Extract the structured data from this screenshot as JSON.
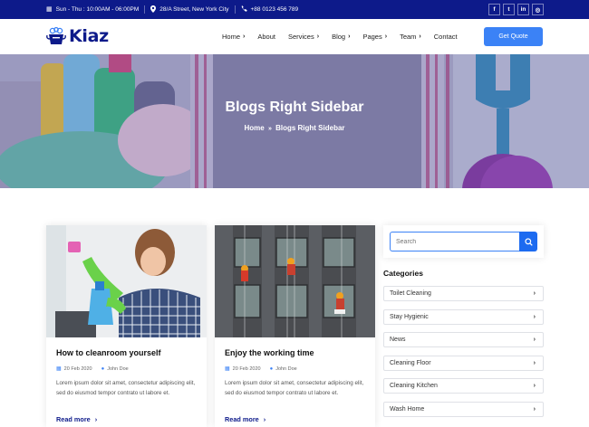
{
  "topbar": {
    "hours": "Sun - Thu : 10:00AM - 06:00PM",
    "address": "28/A Street, New York City",
    "phone": "+88 0123 456 789",
    "social": [
      {
        "name": "facebook-icon",
        "glyph": "f"
      },
      {
        "name": "twitter-icon",
        "glyph": "t"
      },
      {
        "name": "linkedin-icon",
        "glyph": "in"
      },
      {
        "name": "instagram-icon",
        "glyph": "◎"
      }
    ]
  },
  "header": {
    "brand": "Kiaz",
    "nav": [
      {
        "label": "Home",
        "dropdown": true
      },
      {
        "label": "About",
        "dropdown": false
      },
      {
        "label": "Services",
        "dropdown": true
      },
      {
        "label": "Blog",
        "dropdown": true
      },
      {
        "label": "Pages",
        "dropdown": true
      },
      {
        "label": "Team",
        "dropdown": true
      },
      {
        "label": "Contact",
        "dropdown": false
      }
    ],
    "cta": "Get Quote"
  },
  "hero": {
    "title": "Blogs Right Sidebar",
    "crumb_home": "Home",
    "crumb_sep": "»",
    "crumb_current": "Blogs Right Sidebar"
  },
  "posts": [
    {
      "title": "How to cleanroom yourself",
      "date": "20 Feb 2020",
      "author": "John Doe",
      "excerpt": "Lorem ipsum dolor sit amet, consectetur adipiscing elit, sed do eiusmod tempor contrato ut labore et.",
      "read_more": "Read more"
    },
    {
      "title": "Enjoy the working time",
      "date": "20 Feb 2020",
      "author": "John Doe",
      "excerpt": "Lorem ipsum dolor sit amet, consectetur adipiscing elit, sed do eiusmod tempor contrato ut labore et.",
      "read_more": "Read more"
    }
  ],
  "sidebar": {
    "search_placeholder": "Search",
    "categories_title": "Categories",
    "categories": [
      "Toilet Cleaning",
      "Stay Hygienic",
      "News",
      "Cleaning Floor",
      "Cleaning Kitchen",
      "Wash Home"
    ]
  },
  "colors": {
    "topbar_bg": "#0d1a8a",
    "accent": "#3b82f6",
    "brand": "#0d1a8a"
  }
}
